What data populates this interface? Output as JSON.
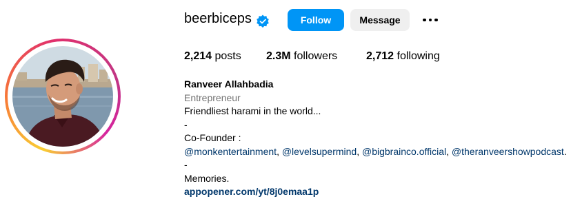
{
  "profile": {
    "username": "beerbiceps",
    "verified": true,
    "avatar_icon": "profile-photo",
    "follow_label": "Follow",
    "message_label": "Message",
    "more_icon": "more-horizontal-icon"
  },
  "stats": {
    "posts_count": "2,214",
    "posts_label": "posts",
    "followers_count": "2.3M",
    "followers_label": "followers",
    "following_count": "2,712",
    "following_label": "following"
  },
  "bio": {
    "full_name": "Ranveer Allahbadia",
    "category": "Entrepreneur",
    "line1": "Friendliest harami in the world...",
    "dash1": "-",
    "cofounder_label": "Co-Founder :",
    "mentions": [
      "@monkentertainment",
      "@levelsupermind",
      "@bigbrainco.official",
      "@theranveershowpodcast"
    ],
    "separator": ", ",
    "end_period": ".",
    "dash2": "-",
    "memories": "Memories.",
    "link": "appopener.com/yt/8j0emaa1p"
  },
  "colors": {
    "accent": "#0095f6",
    "secondary_button": "#efefef",
    "link": "#00376b",
    "muted": "#737373"
  }
}
